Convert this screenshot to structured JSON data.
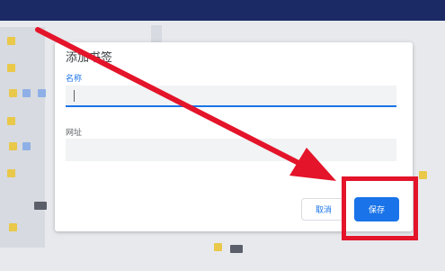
{
  "dialog": {
    "title": "添加书签",
    "name_label": "名称",
    "name_value": "",
    "url_label": "网址",
    "url_value": "",
    "cancel_label": "取消",
    "save_label": "保存"
  },
  "colors": {
    "accent": "#1a73e8",
    "annotation": "#e4142a",
    "topbar": "#1b2a64"
  },
  "annotation": {
    "type": "arrow-and-box",
    "target": "save-button"
  }
}
